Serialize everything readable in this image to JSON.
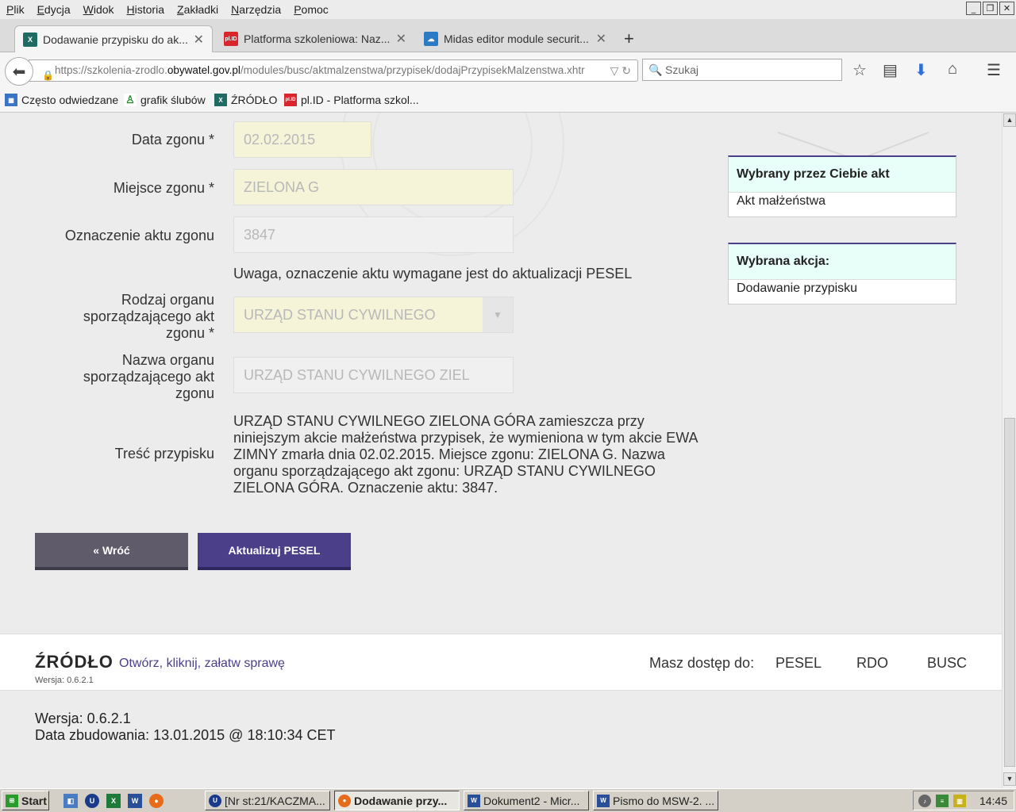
{
  "menu": [
    "Plik",
    "Edycja",
    "Widok",
    "Historia",
    "Zakładki",
    "Narzędzia",
    "Pomoc"
  ],
  "window_buttons": [
    "_",
    "❐",
    "✕"
  ],
  "tabs": [
    {
      "label": "Dodawanie przypisku do ak...",
      "close": "✕",
      "icon": "X"
    },
    {
      "label": "Platforma szkoleniowa: Naz...",
      "close": "✕",
      "icon": "pl.ID"
    },
    {
      "label": "Midas editor module securit...",
      "close": "✕",
      "icon": "☁"
    }
  ],
  "newtab": "+",
  "url": {
    "prefix": "https://szkolenia-zrodlo.",
    "domain": "obywatel.gov.pl",
    "path": "/modules/busc/aktmalzenstwa/przypisek/dodajPrzypisekMalzenstwa.xhtr"
  },
  "search": {
    "placeholder": "Szukaj"
  },
  "bookmarks": [
    {
      "label": "Często odwiedzane",
      "icon": "▦"
    },
    {
      "label": "grafik ślubów",
      "icon": "♙"
    },
    {
      "label": "ŹRÓDŁO",
      "icon": "X"
    },
    {
      "label": "pl.ID - Platforma szkol...",
      "icon": "pl.ID"
    }
  ],
  "form": {
    "date_label": "Data zgonu  *",
    "date_value": "02.02.2015",
    "place_label": "Miejsce zgonu  *",
    "place_value": "ZIELONA G",
    "act_label": "Oznaczenie aktu zgonu",
    "act_value": "3847",
    "warning": "Uwaga, oznaczenie aktu wymagane jest do aktualizacji PESEL",
    "organ_type_label": "Rodzaj organu sporządzającego akt zgonu  *",
    "organ_type_value": "URZĄD STANU CYWILNEGO",
    "organ_name_label": "Nazwa organu sporządzającego akt zgonu",
    "organ_name_value": "URZĄD STANU CYWILNEGO ZIEL",
    "content_label": "Treść przypisku",
    "content_text": "URZĄD STANU CYWILNEGO ZIELONA GÓRA zamieszcza przy niniejszym akcie małżeństwa przypisek, że wymieniona w tym akcie EWA ZIMNY zmarła dnia 02.02.2015. Miejsce zgonu: ZIELONA G. Nazwa organu sporządzającego akt zgonu: URZĄD STANU CYWILNEGO ZIELONA GÓRA. Oznaczenie aktu: 3847."
  },
  "sidebar": {
    "selected_act_header": "Wybrany przez Ciebie akt",
    "selected_act_value": "Akt małżeństwa",
    "selected_action_header": "Wybrana akcja:",
    "selected_action_value": "Dodawanie przypisku"
  },
  "buttons": {
    "back": "« Wróć",
    "update": "Aktualizuj PESEL"
  },
  "footer": {
    "logo": "ŹRÓDŁO",
    "tagline": "Otwórz, kliknij, załatw sprawę",
    "version_small": "Wersja: 0.6.2.1",
    "access_label": "Masz dostęp do:",
    "links": [
      "PESEL",
      "RDO",
      "BUSC"
    ],
    "version": "Wersja: 0.6.2.1",
    "build": "Data zbudowania: 13.01.2015 @ 18:10:34 CET"
  },
  "taskbar": {
    "start": "Start",
    "tasks": [
      "[Nr st:21/KACZMA...",
      "Dodawanie przy...",
      "Dokument2 - Micr...",
      "Pismo do MSW-2. ..."
    ],
    "clock": "14:45"
  },
  "colors": {
    "accent": "#4b3f8a",
    "back_button": "#5f5b6b",
    "required_field": "#f5f3d8",
    "sidebar_header": "#e8fff9"
  }
}
